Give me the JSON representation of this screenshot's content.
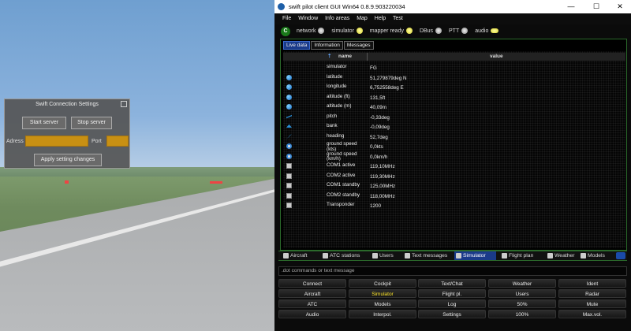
{
  "sim_dialog": {
    "title": "Swift Connection Settings",
    "start_label": "Start server",
    "stop_label": "Stop server",
    "address_label": "Adress",
    "port_label": "Port",
    "apply_label": "Apply setting changes"
  },
  "window": {
    "title": "swift pilot client GUI Win64 0.8.9.903220034",
    "controls": [
      "—",
      "☐",
      "✕"
    ]
  },
  "menu": [
    "File",
    "Window",
    "Info areas",
    "Map",
    "Help",
    "Test"
  ],
  "status": {
    "badge": "C",
    "items": [
      {
        "label": "network",
        "led": "grey"
      },
      {
        "label": "simulator",
        "led": "yellow"
      },
      {
        "label": "mapper ready",
        "led": "yellow"
      },
      {
        "label": "DBus",
        "led": "grey"
      },
      {
        "label": "PTT",
        "led": "grey"
      },
      {
        "label": "audio",
        "led": "yellow"
      }
    ]
  },
  "panel": {
    "tabs": [
      "Live data",
      "Information",
      "Messages"
    ],
    "active_tab": "Live data",
    "columns": {
      "name": "name",
      "value": "value"
    },
    "rows": [
      {
        "icon": "none-icon",
        "name": "simulator",
        "value": "FG"
      },
      {
        "icon": "globe-icon",
        "name": "latitude",
        "value": "51,279879deg N"
      },
      {
        "icon": "globe-icon",
        "name": "longitude",
        "value": "6,752558deg E"
      },
      {
        "icon": "globe-icon",
        "name": "altitude (ft)",
        "value": "131,5ft"
      },
      {
        "icon": "globe-icon",
        "name": "altitude (m)",
        "value": "40,09m"
      },
      {
        "icon": "plane-pitch-icon",
        "name": "pitch",
        "value": "-0,33deg"
      },
      {
        "icon": "plane-bank-icon",
        "name": "bank",
        "value": "-0,09deg"
      },
      {
        "icon": "heading-icon",
        "name": "heading",
        "value": "52,7deg"
      },
      {
        "icon": "speed-icon",
        "name": "ground speed (kts)",
        "value": "0,0kts"
      },
      {
        "icon": "speed-icon",
        "name": "ground speed (km/h)",
        "value": "0,0km/h"
      },
      {
        "icon": "radio-icon",
        "name": "COM1 active",
        "value": "119,10MHz"
      },
      {
        "icon": "radio-icon",
        "name": "COM2 active",
        "value": "119,30MHz"
      },
      {
        "icon": "radio-icon",
        "name": "COM1 standby",
        "value": "125,00MHz"
      },
      {
        "icon": "radio-icon",
        "name": "COM2 standby",
        "value": "118,00MHz"
      },
      {
        "icon": "radio-icon",
        "name": "Transponder",
        "value": "1200"
      }
    ]
  },
  "bottom_tabs": [
    {
      "label": "Aircraft",
      "icon": "aircraft-icon"
    },
    {
      "label": "ATC stations",
      "icon": "atc-icon"
    },
    {
      "label": "Users",
      "icon": "users-icon"
    },
    {
      "label": "Text messages",
      "icon": "text-messages-icon"
    },
    {
      "label": "Simulator",
      "icon": "simulator-icon",
      "active": true
    },
    {
      "label": "Flight plan",
      "icon": "flight-plan-icon"
    },
    {
      "label": "Weather",
      "icon": "weather-icon"
    },
    {
      "label": "Models",
      "icon": "models-icon"
    }
  ],
  "command_line": {
    "placeholder": ".dot commands or text message"
  },
  "keypad": [
    [
      "Connect",
      "Cockpit",
      "Text/Chat",
      "Weather",
      "Ident"
    ],
    [
      "Aircraft",
      "Simulator",
      "Flight pl.",
      "Users",
      "Radar"
    ],
    [
      "ATC",
      "Models",
      "Log",
      "50%",
      "Mute"
    ],
    [
      "Audio",
      "Interpol.",
      "Settings",
      "100%",
      "Max.vol."
    ]
  ],
  "keypad_highlight": "Simulator",
  "colors": {
    "accent": "#1a3a8a",
    "panel_border": "#2b6a2b",
    "highlight_text": "#ffe62a"
  }
}
